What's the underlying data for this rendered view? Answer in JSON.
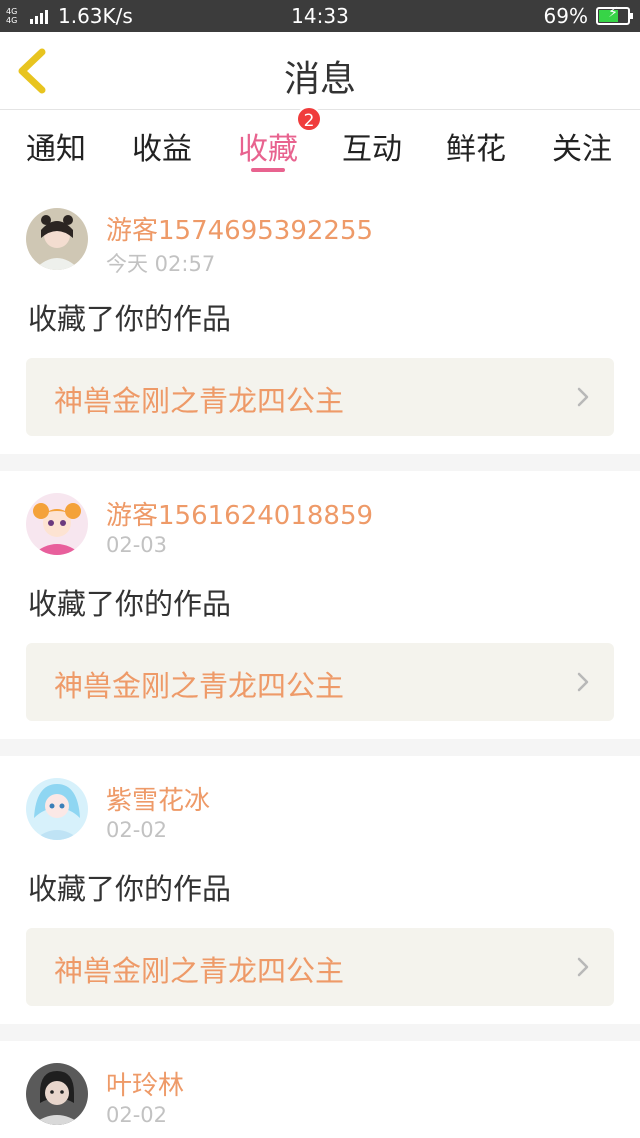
{
  "status_bar": {
    "network": "4G 4G",
    "speed": "1.63K/s",
    "time": "14:33",
    "battery": "69%",
    "battery_level": 0.69
  },
  "header": {
    "title": "消息"
  },
  "tabs": [
    {
      "label": "通知"
    },
    {
      "label": "收益"
    },
    {
      "label": "收藏",
      "active": true,
      "badge": "2"
    },
    {
      "label": "互动"
    },
    {
      "label": "鲜花"
    },
    {
      "label": "关注"
    }
  ],
  "colors": {
    "accent": "#e8638f",
    "username": "#ee9a68",
    "badge": "#f03c3c",
    "link_bg": "#f4f3ed",
    "back_arrow": "#e8c41f"
  },
  "messages": [
    {
      "user": "游客1574695392255",
      "time": "今天 02:57",
      "action": "收藏了你的作品",
      "work": "神兽金刚之青龙四公主"
    },
    {
      "user": "游客1561624018859",
      "time": "02-03",
      "action": "收藏了你的作品",
      "work": "神兽金刚之青龙四公主"
    },
    {
      "user": "紫雪花冰",
      "time": "02-02",
      "action": "收藏了你的作品",
      "work": "神兽金刚之青龙四公主"
    },
    {
      "user": "叶玲林",
      "time": "02-02",
      "action": "",
      "work": ""
    }
  ]
}
